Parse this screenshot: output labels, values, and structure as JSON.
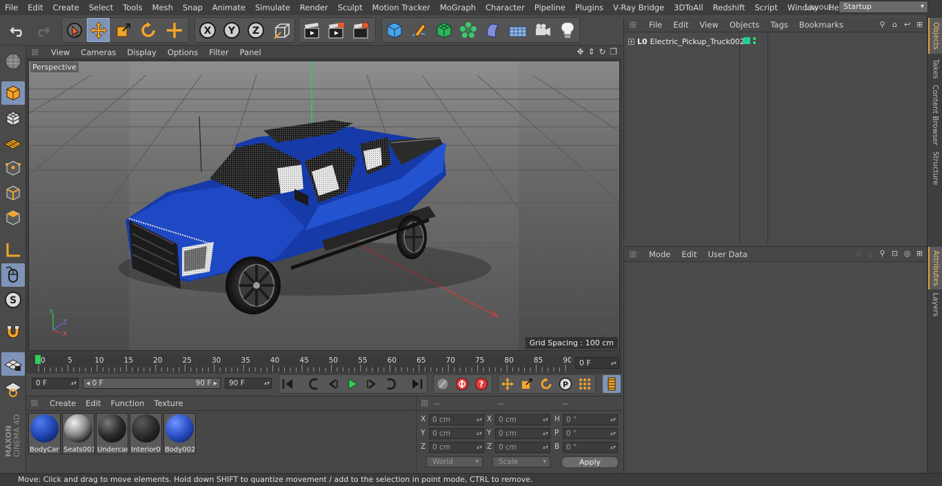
{
  "menubar": {
    "items": [
      "File",
      "Edit",
      "Create",
      "Select",
      "Tools",
      "Mesh",
      "Snap",
      "Animate",
      "Simulate",
      "Render",
      "Sculpt",
      "Motion Tracker",
      "MoGraph",
      "Character",
      "Pipeline",
      "Plugins",
      "V-Ray Bridge",
      "3DToAll",
      "Redshift",
      "Script",
      "Window",
      "Help"
    ],
    "layout_label": "Layout:",
    "layout_value": "Startup"
  },
  "viewport": {
    "menu": [
      "View",
      "Cameras",
      "Display",
      "Options",
      "Filter",
      "Panel"
    ],
    "camera_label": "Perspective",
    "grid_spacing": "Grid Spacing : 100 cm",
    "axis_labels": {
      "y": "Y",
      "z": "Z",
      "x": "X"
    },
    "truck_color": "#1f48c4"
  },
  "timeline": {
    "ticks": [
      "0",
      "5",
      "10",
      "15",
      "20",
      "25",
      "30",
      "35",
      "40",
      "45",
      "50",
      "55",
      "60",
      "65",
      "70",
      "75",
      "80",
      "85",
      "90"
    ],
    "current_frame": "0 F"
  },
  "playback": {
    "start_field": "0 F",
    "range_start": "◂ 0 F",
    "range_end": "90 F ▸",
    "end_field": "90 F"
  },
  "materials": {
    "menu": [
      "Create",
      "Edit",
      "Function",
      "Texture"
    ],
    "items": [
      {
        "name": "BodyCar",
        "color": "#1d3fa8"
      },
      {
        "name": "Seats001",
        "color": "#cfcfcf"
      },
      {
        "name": "Undercar",
        "color": "#1a1a1a"
      },
      {
        "name": "Interior0",
        "color": "#2a2a2a"
      },
      {
        "name": "Body002",
        "color": "#2c4fc4"
      }
    ]
  },
  "coordinates": {
    "headers": [
      "--",
      "--",
      "--"
    ],
    "rows": [
      {
        "l1": "X",
        "v1": "0 cm",
        "l2": "X",
        "v2": "0 cm",
        "l3": "H",
        "v3": "0 °"
      },
      {
        "l1": "Y",
        "v1": "0 cm",
        "l2": "Y",
        "v2": "0 cm",
        "l3": "P",
        "v3": "0 °"
      },
      {
        "l1": "Z",
        "v1": "0 cm",
        "l2": "Z",
        "v2": "0 cm",
        "l3": "B",
        "v3": "0 °"
      }
    ],
    "world_label": "World",
    "scale_label": "Scale",
    "apply_label": "Apply"
  },
  "objects": {
    "menu": [
      "File",
      "Edit",
      "View",
      "Objects",
      "Tags",
      "Bookmarks"
    ],
    "object_name": "Electric_Pickup_Truck002",
    "null_icon": "L0"
  },
  "attributes": {
    "menu": [
      "Mode",
      "Edit",
      "User Data"
    ]
  },
  "right_tabs": {
    "top": [
      "Objects",
      "Takes",
      "Content Browser",
      "Structure"
    ],
    "bottom": [
      "Attributes",
      "Layers"
    ]
  },
  "status": {
    "message": "Move: Click and drag to move elements. Hold down SHIFT to quantize movement / add to the selection in point mode, CTRL to remove."
  },
  "branding": {
    "logo_line1": "MAXON",
    "logo_line2": "CINEMA 4D"
  }
}
